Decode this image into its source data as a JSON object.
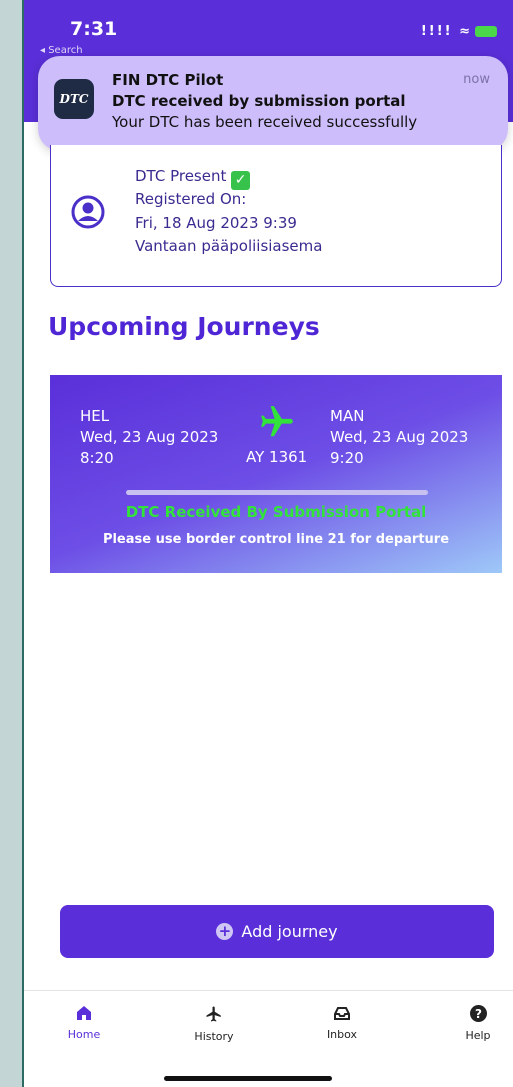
{
  "status_bar": {
    "time": "7:31",
    "back_label": "◂ Search",
    "signal": "!!!! ≈"
  },
  "notification": {
    "icon_text": "DTC",
    "app_name": "FIN DTC Pilot",
    "title": "DTC received by submission portal",
    "body": "Your DTC has been received successfully",
    "time": "now"
  },
  "dtc_card": {
    "present_label": "DTC Present",
    "registered_label": "Registered On:",
    "registered_date": "Fri, 18 Aug 2023 9:39",
    "location": "Vantaan pääpoliisiasema"
  },
  "section_title": "Upcoming Journeys",
  "journey": {
    "from_code": "HEL",
    "from_date": "Wed, 23 Aug 2023",
    "from_time": "8:20",
    "to_code": "MAN",
    "to_date": "Wed, 23 Aug 2023",
    "to_time": "9:20",
    "flight": "AY 1361",
    "status": "DTC Received By Submission Portal",
    "note": "Please use border control line 21 for departure",
    "status_color": "#32e33a"
  },
  "add_button": {
    "label": "Add journey"
  },
  "tabs": [
    {
      "label": "Home",
      "icon": "home-icon",
      "active": true
    },
    {
      "label": "History",
      "icon": "airplane-icon",
      "active": false
    },
    {
      "label": "Inbox",
      "icon": "inbox-icon",
      "active": false
    },
    {
      "label": "Help",
      "icon": "help-icon",
      "active": false
    }
  ],
  "colors": {
    "brand": "#5a2fd9",
    "notification_bg": "#cdbdfb",
    "side_bg": "#c4d5d5"
  }
}
